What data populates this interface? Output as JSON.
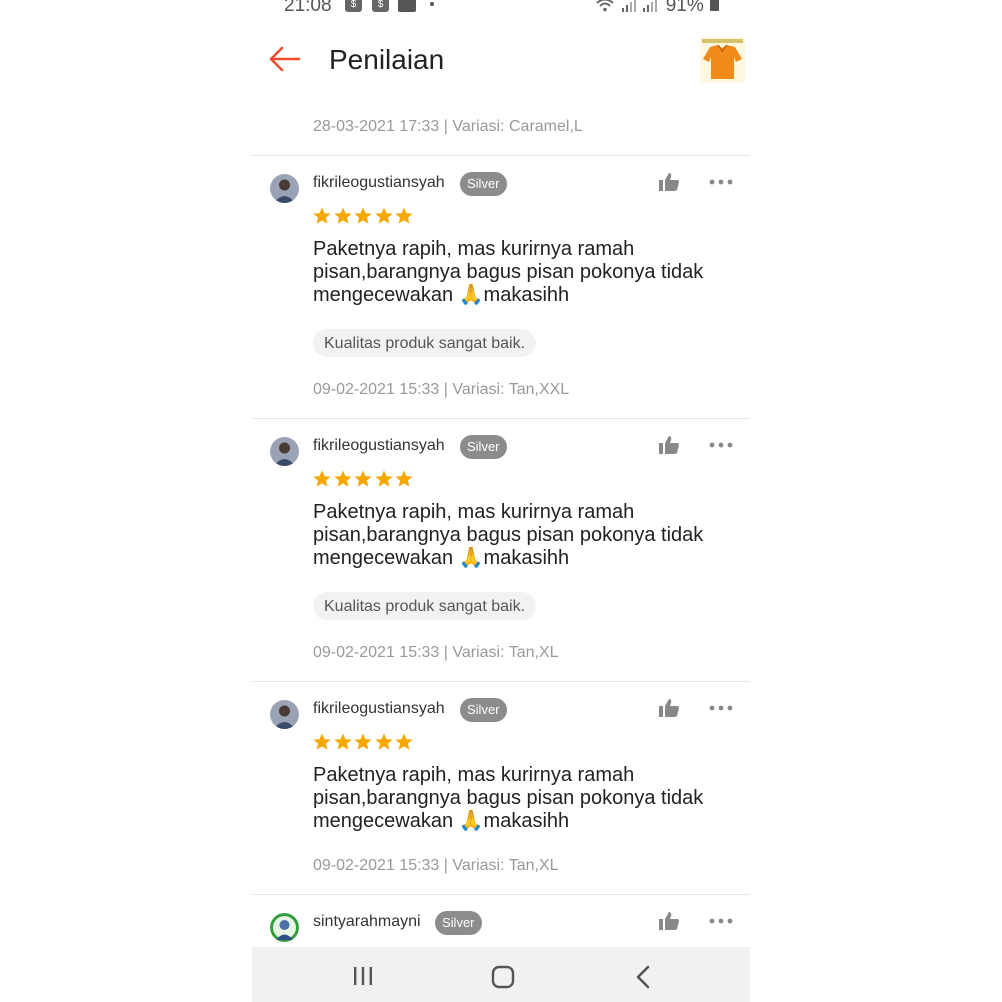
{
  "status_bar": {
    "time": "21:08",
    "battery": "91%"
  },
  "header": {
    "title": "Penilaian"
  },
  "first_meta": "28-03-2021 17:33 | Variasi: Caramel,L",
  "reviews": [
    {
      "username": "fikrileogustiansyah",
      "badge": "Silver",
      "rating": 5,
      "text": "Paketnya rapih, mas kurirnya ramah pisan,barangnya bagus pisan pokonya tidak mengecewakan 🙏makasihh",
      "tag": "Kualitas produk sangat baik.",
      "meta": "09-02-2021 15:33 | Variasi: Tan,XXL"
    },
    {
      "username": "fikrileogustiansyah",
      "badge": "Silver",
      "rating": 5,
      "text": "Paketnya rapih, mas kurirnya ramah pisan,barangnya bagus pisan pokonya tidak mengecewakan 🙏makasihh",
      "tag": "Kualitas produk sangat baik.",
      "meta": "09-02-2021 15:33 | Variasi: Tan,XL"
    },
    {
      "username": "fikrileogustiansyah",
      "badge": "Silver",
      "rating": 5,
      "text": "Paketnya rapih, mas kurirnya ramah pisan,barangnya bagus pisan pokonya tidak mengecewakan 🙏makasihh",
      "meta": "09-02-2021 15:33 | Variasi: Tan,XL"
    },
    {
      "username": "sintyarahmayni",
      "badge": "Silver"
    }
  ],
  "colors": {
    "accent": "#ee4d2d",
    "star": "#f6a700",
    "badge": "#8c8c8c"
  }
}
